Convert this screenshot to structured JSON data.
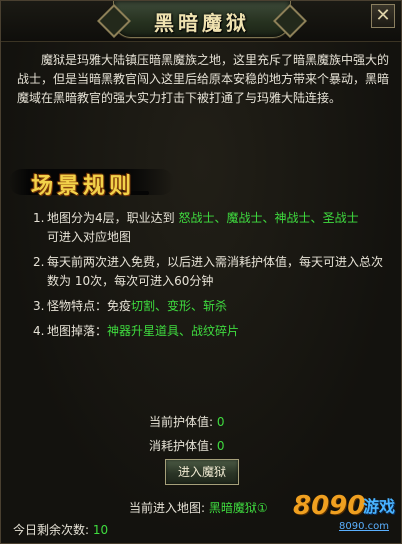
{
  "window": {
    "title": "黑暗魔狱",
    "close_label": "✕"
  },
  "intro": "魔狱是玛雅大陆镇压暗黑魔族之地，这里充斥了暗黑魔族中强大的战士，但是当暗黑教官闯入这里后给原本安稳的地方带来个暴动，黑暗魔域在黑暗教官的强大实力打击下被打通了与玛雅大陆连接。",
  "section_title": "场景规则",
  "rules": [
    {
      "num": "1.",
      "line1_prefix": "地图分为4层，职业达到",
      "classes": [
        "怒战士",
        "魔战士",
        "神战士",
        "圣战士"
      ],
      "separator": "、",
      "line2": "可进入对应地图"
    },
    {
      "num": "2.",
      "text": "每天前两次进入免费，以后进入需消耗护体值，每天可进入总次数为 10次，每次可进入60分钟"
    },
    {
      "num": "3.",
      "prefix": "怪物特点：免疫",
      "highlight": "切割、变形、斩杀"
    },
    {
      "num": "4.",
      "prefix": "地图掉落：",
      "highlight": "神器升星道具、战纹碎片"
    }
  ],
  "status": {
    "current_protect_label": "当前护体值:",
    "current_protect_value": "0",
    "cost_protect_label": "消耗护体值:",
    "cost_protect_value": "0",
    "enter_button": "进入魔狱",
    "current_map_label": "当前进入地图:",
    "current_map_value": "黑暗魔狱①",
    "remaining_label": "今日剩余次数:",
    "remaining_value": "10"
  },
  "watermark": {
    "digits": "8090",
    "site": "游戏",
    "url": "8090.com"
  },
  "colors": {
    "highlight": "#3fdc3f",
    "title": "#efe2b0",
    "section_title": "#f2d24a"
  }
}
